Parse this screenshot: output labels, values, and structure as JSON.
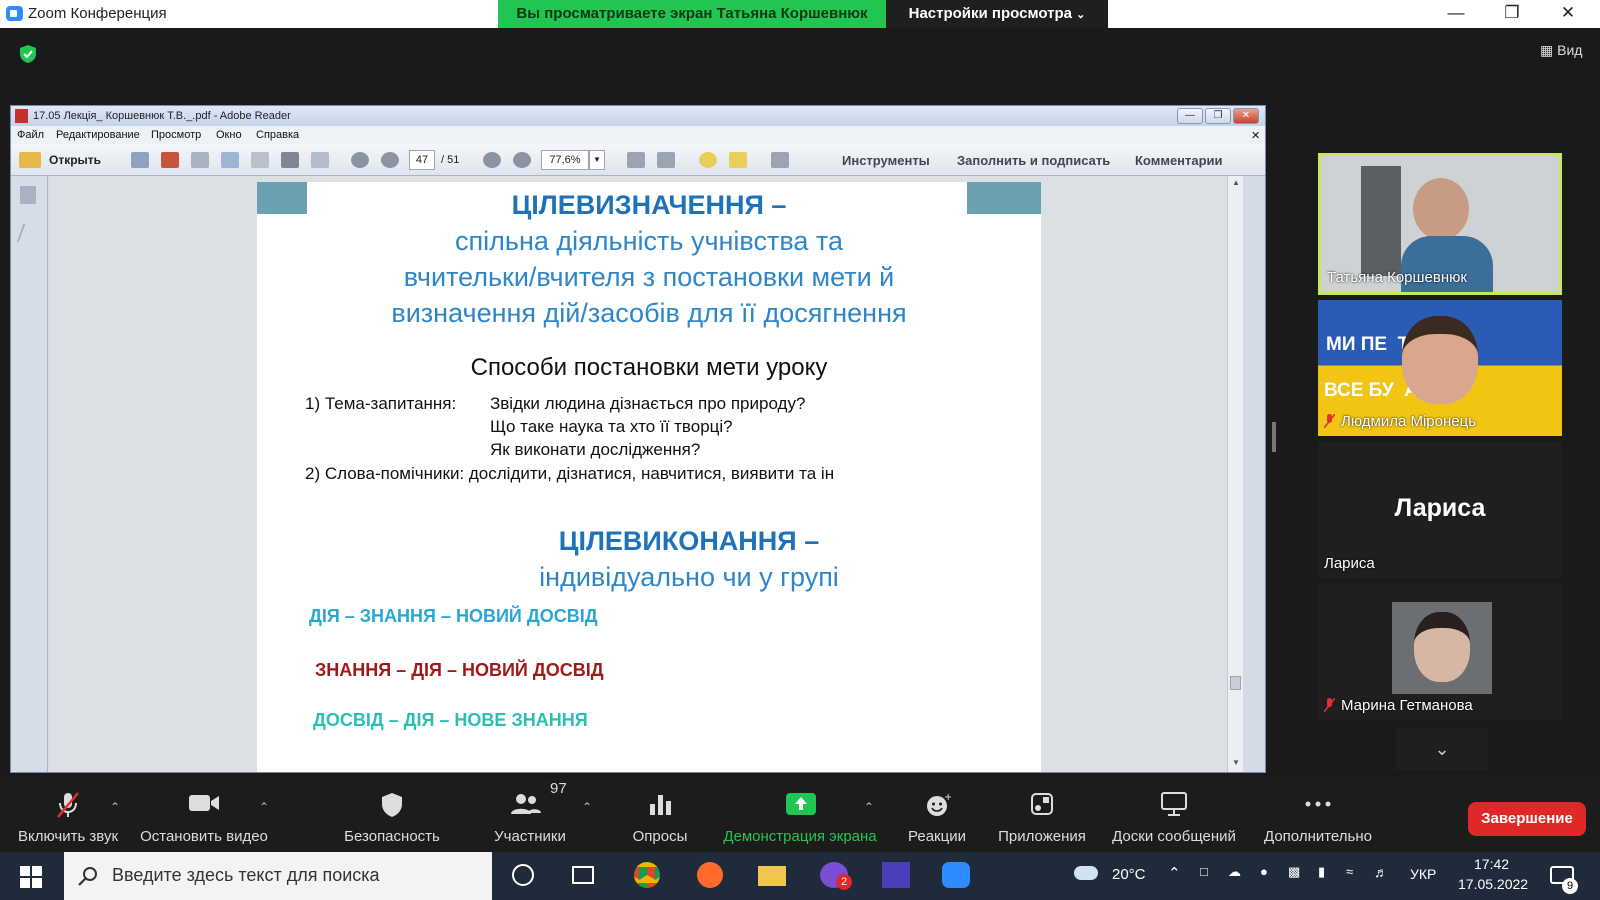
{
  "zoom": {
    "window_title": "Zoom Конференция",
    "share_banner": "Вы просматриваете экран Татьяна Коршевнюк",
    "view_settings": "Настройки просмотра",
    "view_button": "Вид",
    "controls": [
      {
        "label": "Включить звук",
        "icon": "mic-muted-icon"
      },
      {
        "label": "Остановить видео",
        "icon": "video-camera-icon"
      },
      {
        "label": "Безопасность",
        "icon": "shield-icon"
      },
      {
        "label": "Участники",
        "icon": "participants-icon",
        "count": "97"
      },
      {
        "label": "Опросы",
        "icon": "bar-chart-icon"
      },
      {
        "label": "Демонстрация экрана",
        "icon": "share-screen-icon"
      },
      {
        "label": "Реакции",
        "icon": "emoji-icon"
      },
      {
        "label": "Приложения",
        "icon": "apps-icon"
      },
      {
        "label": "Доски сообщений",
        "icon": "whiteboard-icon"
      },
      {
        "label": "Дополнительно",
        "icon": "more-icon"
      }
    ],
    "end_button": "Завершение",
    "accent_green": "#23c552",
    "end_red": "#e02828"
  },
  "participants": [
    {
      "name": "Татьяна Коршевнюк",
      "muted": false,
      "active": true
    },
    {
      "name": "Людмила Міронець",
      "muted": true,
      "banner_top": "МИ ПЕ  ТЕМО!",
      "banner_bottom": "ВСЕ БУ  АЇНА!"
    },
    {
      "name": "Лариса",
      "muted": false,
      "avatar_text": "Лариса"
    },
    {
      "name": "Марина Гетманова",
      "muted": true
    }
  ],
  "adobe": {
    "title": "17.05 Лекція_ Коршевнюк Т.В._.pdf - Adobe Reader",
    "menu": [
      "Файл",
      "Редактирование",
      "Просмотр",
      "Окно",
      "Справка"
    ],
    "open_label": "Открыть",
    "page_current": "47",
    "page_total": "/ 51",
    "zoom": "77,6%",
    "tools": "Инструменты",
    "fill_sign": "Заполнить и подписать",
    "comments": "Комментарии"
  },
  "slide": {
    "heading1": "ЦІЛЕВИЗНАЧЕННЯ –",
    "sub1": [
      "спільна діяльність учнівства та",
      "вчительки/вчителя з постановки мети й",
      "визначення дій/засобів для її досягнення"
    ],
    "methods_title": "Способи постановки мети уроку",
    "item1_label": "1)  Тема-запитання:",
    "item1_q1": "Звідки людина дізнається про природу?",
    "item1_q2": "Що таке наука та хто її творці?",
    "item1_q3": "Як виконати дослідження?",
    "item2": "2) Слова-помічники: дослідити, дізнатися, навчитися, виявити та ін",
    "heading2": "ЦІЛЕВИКОНАННЯ –",
    "sub2": "індивідуально чи у групі",
    "seq1": "ДІЯ – ЗНАННЯ –  НОВИЙ ДОСВІД",
    "seq2": "ЗНАННЯ – ДІЯ – НОВИЙ ДОСВІД",
    "seq3": "ДОСВІД – ДІЯ – НОВЕ ЗНАННЯ",
    "colors": {
      "heading": "#1f72b8",
      "sub": "#2e86c9",
      "seq1": "#2aa6d6",
      "seq2": "#a11a1a",
      "seq3": "#2bbfb4"
    }
  },
  "taskbar": {
    "search_placeholder": "Введите здесь текст для поиска",
    "temperature": "20°C",
    "language": "УКР",
    "time": "17:42",
    "date": "17.05.2022",
    "viber_badge": "2",
    "notif_badge": "9"
  }
}
